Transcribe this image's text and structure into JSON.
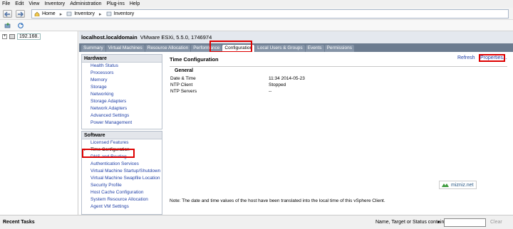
{
  "menu": [
    "File",
    "Edit",
    "View",
    "Inventory",
    "Administration",
    "Plug-ins",
    "Help"
  ],
  "breadcrumb": {
    "home": "Home",
    "inventory1": "Inventory",
    "inventory2": "Inventory"
  },
  "tree": {
    "expander": "+",
    "host": "192.168."
  },
  "host_header": {
    "name": "localhost.localdomain",
    "product": "VMware ESXi, 5.5.0, 1746974"
  },
  "tabs": [
    "Summary",
    "Virtual Machines",
    "Resource Allocation",
    "Performance",
    "Configuration",
    "Local Users & Groups",
    "Events",
    "Permissions"
  ],
  "hardware": {
    "title": "Hardware",
    "items": [
      "Health Status",
      "Processors",
      "Memory",
      "Storage",
      "Networking",
      "Storage Adapters",
      "Network Adapters",
      "Advanced Settings",
      "Power Management"
    ]
  },
  "software": {
    "title": "Software",
    "items": [
      "Licensed Features",
      "Time Configuration",
      "DNS and Routing",
      "Authentication Services",
      "Virtual Machine Startup/Shutdown",
      "Virtual Machine Swapfile Location",
      "Security Profile",
      "Host Cache Configuration",
      "System Resource Allocation",
      "Agent VM Settings"
    ]
  },
  "time_config": {
    "title": "Time Configuration",
    "refresh": "Refresh",
    "properties": "Properties...",
    "general": "General",
    "rows": [
      {
        "label": "Date & Time",
        "value": "11:34  2014-05-23"
      },
      {
        "label": "NTP Client",
        "value": "Stopped"
      },
      {
        "label": "NTP Servers",
        "value": "--"
      }
    ]
  },
  "watermark": "mizniz.net",
  "note": "Note: The date and time values of the host have been translated into the local time of this vSphere Client.",
  "status": {
    "recent_tasks": "Recent Tasks",
    "filter_label": "Name, Target or Status contains:",
    "filter_dropdown": "▾",
    "filter_value": "",
    "clear": "Clear"
  },
  "colors": {
    "highlight": "#dd0000",
    "link": "#1f3fa6",
    "tab_bg": "#6b7b8f"
  }
}
